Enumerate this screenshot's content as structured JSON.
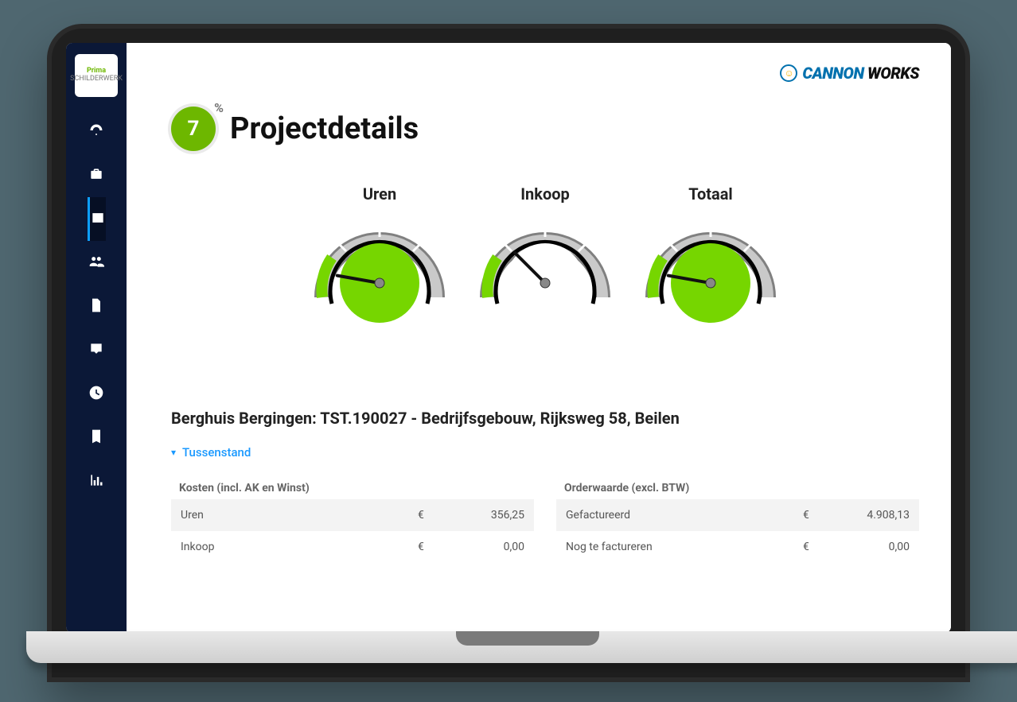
{
  "brand": {
    "part1": "CANNON",
    "part2": "WORKS"
  },
  "sidebar_logo": {
    "line1": "Prima",
    "line2": "SCHILDERWERK"
  },
  "nav_items": [
    {
      "name": "dashboard",
      "active": false
    },
    {
      "name": "briefcase",
      "active": false
    },
    {
      "name": "news",
      "active": true
    },
    {
      "name": "users",
      "active": false
    },
    {
      "name": "document",
      "active": false
    },
    {
      "name": "inbox",
      "active": false
    },
    {
      "name": "clock",
      "active": false
    },
    {
      "name": "book",
      "active": false
    },
    {
      "name": "stats",
      "active": false
    }
  ],
  "header": {
    "badge": "7",
    "badge_pct": "%",
    "title": "Projectdetails"
  },
  "gauges": [
    {
      "label": "Uren",
      "fill": "#76d600",
      "needle_deg": 190
    },
    {
      "label": "Inkoop",
      "fill": "#ffffff",
      "needle_deg": 225
    },
    {
      "label": "Totaal",
      "fill": "#76d600",
      "needle_deg": 190
    }
  ],
  "project_line": "Berghuis Bergingen: TST.190027 - Bedrijfsgebouw, Rijksweg 58, Beilen",
  "accordion": {
    "label": "Tussenstand"
  },
  "tables": {
    "left": {
      "header": "Kosten (incl. AK en Winst)",
      "rows": [
        {
          "label": "Uren",
          "currency": "€",
          "value": "356,25"
        },
        {
          "label": "Inkoop",
          "currency": "€",
          "value": "0,00"
        }
      ]
    },
    "right": {
      "header": "Orderwaarde (excl. BTW)",
      "rows": [
        {
          "label": "Gefactureerd",
          "currency": "€",
          "value": "4.908,13"
        },
        {
          "label": "Nog te factureren",
          "currency": "€",
          "value": "0,00"
        }
      ]
    }
  },
  "chart_data": [
    {
      "type": "gauge",
      "title": "Uren",
      "value": 10,
      "range": [
        0,
        100
      ],
      "filled": true
    },
    {
      "type": "gauge",
      "title": "Inkoop",
      "value": 40,
      "range": [
        0,
        100
      ],
      "filled": false
    },
    {
      "type": "gauge",
      "title": "Totaal",
      "value": 10,
      "range": [
        0,
        100
      ],
      "filled": true
    }
  ]
}
